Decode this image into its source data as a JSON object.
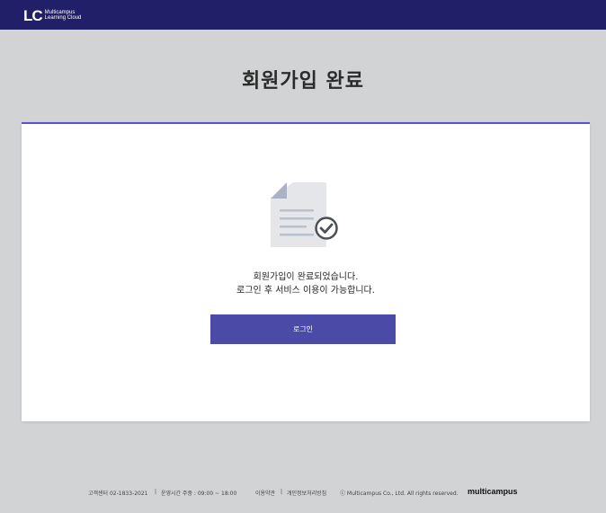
{
  "header": {
    "logo_mark": "LC",
    "logo_line1": "Multicampus",
    "logo_line2": "Learning Cloud"
  },
  "page_title": "회원가입 완료",
  "message": {
    "line1": "회원가입이 완료되었습니다.",
    "line2": "로그인 후 서비스 이용이 가능합니다."
  },
  "login_button_label": "로그인",
  "footer": {
    "customer_center": "고객센터 02-1833-2021",
    "separator1": "|",
    "hours": "운영시간 주중 : 09:00 ~ 18:00",
    "terms": "이용약관",
    "separator2": "|",
    "privacy": "개인정보처리방침",
    "copyright": "ⓒ Multicampus Co., Ltd. All rights reserved.",
    "brand": "multicampus"
  },
  "colors": {
    "header_bg": "#211f67",
    "accent": "#5a52c9",
    "button_bg": "#4b4ba7",
    "page_bg": "#d2d3d5"
  }
}
